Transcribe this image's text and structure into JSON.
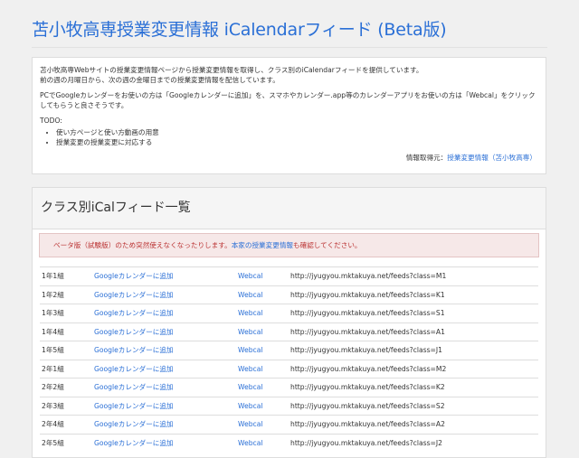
{
  "header": {
    "title": "苫小牧高専授業変更情報 iCalendarフィード (Beta版)"
  },
  "info": {
    "line1": "苫小牧高専Webサイトの授業変更情報ページから授業変更情報を取得し、クラス別のiCalendarフィードを提供しています。",
    "line2": "前の週の月曜日から、次の週の金曜日までの授業変更情報を配信しています。",
    "line3": "PCでGoogleカレンダーをお使いの方は「Googleカレンダーに追加」を、スマホやカレンダー.app等のカレンダーアプリをお使いの方は「Webcal」をクリックしてもらうと良さそうです。",
    "todo_label": "TODO:",
    "todo_items": [
      "使い方ページと使い方動画の用意",
      "授業変更の授業変更に対応する"
    ],
    "source_label": "情報取得元：",
    "source_link": "授業変更情報（苫小牧高専）"
  },
  "panel": {
    "title": "クラス別iCalフィード一覧",
    "alert_text": "ベータ版（試験版）のため突然使えなくなったりします。",
    "alert_link": "本家の授業変更情報",
    "alert_tail": "も確認してください。"
  },
  "feeds": [
    {
      "cls": "1年1組",
      "google": "Googleカレンダーに追加",
      "webcal": "Webcal",
      "url": "http://jyugyou.mktakuya.net/feeds?class=M1"
    },
    {
      "cls": "1年2組",
      "google": "Googleカレンダーに追加",
      "webcal": "Webcal",
      "url": "http://jyugyou.mktakuya.net/feeds?class=K1"
    },
    {
      "cls": "1年3組",
      "google": "Googleカレンダーに追加",
      "webcal": "Webcal",
      "url": "http://jyugyou.mktakuya.net/feeds?class=S1"
    },
    {
      "cls": "1年4組",
      "google": "Googleカレンダーに追加",
      "webcal": "Webcal",
      "url": "http://jyugyou.mktakuya.net/feeds?class=A1"
    },
    {
      "cls": "1年5組",
      "google": "Googleカレンダーに追加",
      "webcal": "Webcal",
      "url": "http://jyugyou.mktakuya.net/feeds?class=J1"
    },
    {
      "cls": "2年1組",
      "google": "Googleカレンダーに追加",
      "webcal": "Webcal",
      "url": "http://jyugyou.mktakuya.net/feeds?class=M2"
    },
    {
      "cls": "2年2組",
      "google": "Googleカレンダーに追加",
      "webcal": "Webcal",
      "url": "http://jyugyou.mktakuya.net/feeds?class=K2"
    },
    {
      "cls": "2年3組",
      "google": "Googleカレンダーに追加",
      "webcal": "Webcal",
      "url": "http://jyugyou.mktakuya.net/feeds?class=S2"
    },
    {
      "cls": "2年4組",
      "google": "Googleカレンダーに追加",
      "webcal": "Webcal",
      "url": "http://jyugyou.mktakuya.net/feeds?class=A2"
    },
    {
      "cls": "2年5組",
      "google": "Googleカレンダーに追加",
      "webcal": "Webcal",
      "url": "http://jyugyou.mktakuya.net/feeds?class=J2"
    }
  ],
  "colors": {
    "link": "#2a6fd6",
    "alert_text": "#b33333",
    "alert_bg": "#f6e8e8"
  }
}
